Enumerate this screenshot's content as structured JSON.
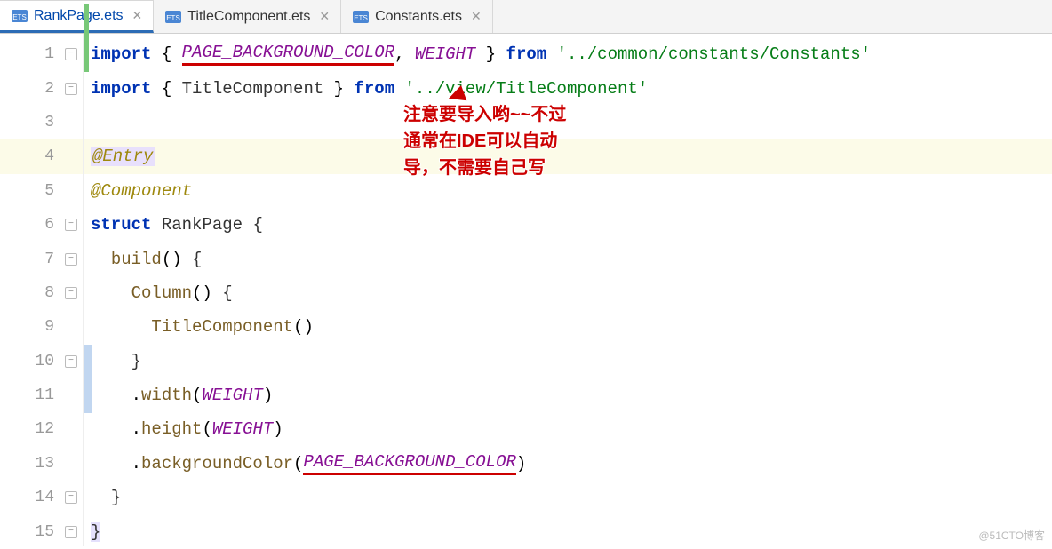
{
  "tabs": [
    {
      "name": "RankPage.ets",
      "active": true
    },
    {
      "name": "TitleComponent.ets",
      "active": false
    },
    {
      "name": "Constants.ets",
      "active": false
    }
  ],
  "line_numbers": [
    "1",
    "2",
    "3",
    "4",
    "5",
    "6",
    "7",
    "8",
    "9",
    "10",
    "11",
    "12",
    "13",
    "14",
    "15"
  ],
  "code": {
    "l1": {
      "import": "import",
      "lbrace": " { ",
      "c1": "PAGE_BACKGROUND_COLOR",
      "comma": ", ",
      "c2": "WEIGHT",
      "rbrace": " } ",
      "from": "from",
      "sp": " ",
      "path": "'../common/constants/Constants'"
    },
    "l2": {
      "import": "import",
      "lbrace": " { ",
      "c1": "TitleComponent",
      "rbrace": " } ",
      "from": "from",
      "sp": " ",
      "path": "'../view/TitleComponent'"
    },
    "l4": {
      "deco": "@Entry"
    },
    "l5": {
      "deco": "@Component"
    },
    "l6": {
      "kw": "struct",
      "name": " RankPage ",
      "brace": "{"
    },
    "l7": {
      "indent": "  ",
      "fn": "build",
      "paren": "() ",
      "brace": "{"
    },
    "l8": {
      "indent": "    ",
      "fn": "Column",
      "paren": "() ",
      "brace": "{"
    },
    "l9": {
      "indent": "      ",
      "fn": "TitleComponent",
      "paren": "()"
    },
    "l10": {
      "indent": "    ",
      "brace": "}"
    },
    "l11": {
      "indent": "    ",
      "dot": ".",
      "prop": "width",
      "lp": "(",
      "arg": "WEIGHT",
      "rp": ")"
    },
    "l12": {
      "indent": "    ",
      "dot": ".",
      "prop": "height",
      "lp": "(",
      "arg": "WEIGHT",
      "rp": ")"
    },
    "l13": {
      "indent": "    ",
      "dot": ".",
      "prop": "backgroundColor",
      "lp": "(",
      "arg": "PAGE_BACKGROUND_COLOR",
      "rp": ")"
    },
    "l14": {
      "indent": "  ",
      "brace": "}"
    },
    "l15": {
      "brace": "}"
    }
  },
  "annotation": {
    "line1": "注意要导入哟~~不过",
    "line2": "通常在IDE可以自动",
    "line3": "导，不需要自己写"
  },
  "watermark": "@51CTO博客"
}
